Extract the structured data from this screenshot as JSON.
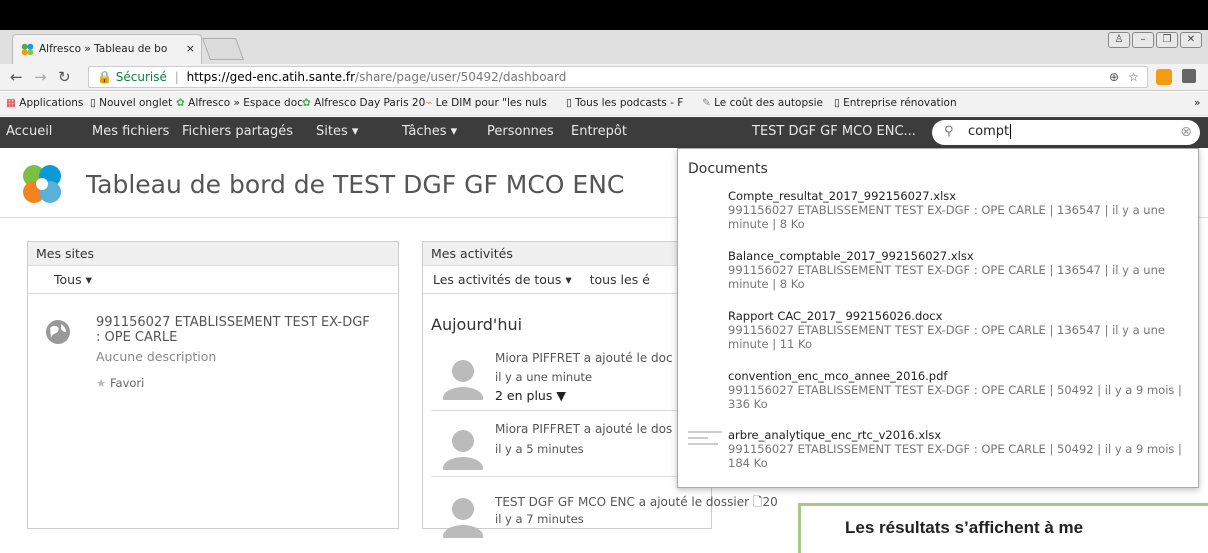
{
  "browser": {
    "tab_title": "Alfresco » Tableau de bo",
    "tab_close": "×",
    "secure_label": "Sécurisé",
    "url_host": "https://ged-enc.atih.sante.fr",
    "url_path": "/share/page/user/50492/dashboard",
    "bookmarks": [
      "Applications",
      "Nouvel onglet",
      "Alfresco » Espace doc",
      "Alfresco Day Paris 20",
      "Le DIM pour \"les nuls",
      "Tous les podcasts - F",
      "Le coût des autopsie",
      "Entreprise rénovation"
    ],
    "more_bookmarks": "»"
  },
  "nav": {
    "items": [
      "Accueil",
      "Mes fichiers",
      "Fichiers partagés",
      "Sites ▾",
      "Tâches ▾",
      "Personnes",
      "Entrepôt"
    ],
    "site_name": "TEST DGF GF MCO ENC...",
    "search_value": "compt"
  },
  "page": {
    "title": "Tableau de bord de TEST DGF GF MCO ENC"
  },
  "my_sites": {
    "header": "Mes sites",
    "filter": "Tous ▾",
    "site_name": "991156027 ETABLISSEMENT TEST EX-DGF : OPE CARLE",
    "description": "Aucune description",
    "favorite": "Favori"
  },
  "activities": {
    "header": "Mes activités",
    "filter_who": "Les activités de tous ▾",
    "filter_when": "tous les é",
    "today": "Aujourd'hui",
    "items": [
      {
        "text": "Miora PIFFRET a ajouté le doc",
        "time": "il y a une minute",
        "more": "2 en plus ▼"
      },
      {
        "text": "Miora PIFFRET a ajouté le dos",
        "time": "il y a 5 minutes",
        "more": ""
      },
      {
        "text": "TEST DGF GF MCO ENC a ajouté le dossier",
        "folder": "20",
        "time": "il y a 7 minutes",
        "more": ""
      }
    ]
  },
  "search_results": {
    "header": "Documents",
    "items": [
      {
        "name": "Compte_resultat_2017_992156027.xlsx",
        "meta": "991156027 ETABLISSEMENT TEST EX-DGF : OPE CARLE | 136547 | il y a une minute | 8 Ko"
      },
      {
        "name": "Balance_comptable_2017_992156027.xlsx",
        "meta": "991156027 ETABLISSEMENT TEST EX-DGF : OPE CARLE | 136547 | il y a une minute | 8 Ko"
      },
      {
        "name": "Rapport CAC_2017_ 992156026.docx",
        "meta": "991156027 ETABLISSEMENT TEST EX-DGF : OPE CARLE | 136547 | il y a une minute | 11 Ko"
      },
      {
        "name": "convention_enc_mco_annee_2016.pdf",
        "meta": "991156027 ETABLISSEMENT TEST EX-DGF : OPE CARLE | 50492 | il y a 9 mois | 336 Ko"
      },
      {
        "name": "arbre_analytique_enc_rtc_v2016.xlsx",
        "meta": "991156027 ETABLISSEMENT TEST EX-DGF : OPE CARLE | 50492 | il y a 9 mois | 184 Ko"
      }
    ]
  },
  "callout": {
    "text": "Les résultats s’affichent à me"
  },
  "colors": {
    "nav_bg": "#3c3c3c",
    "secure_green": "#0b8043",
    "callout_border": "#a8c68a"
  }
}
